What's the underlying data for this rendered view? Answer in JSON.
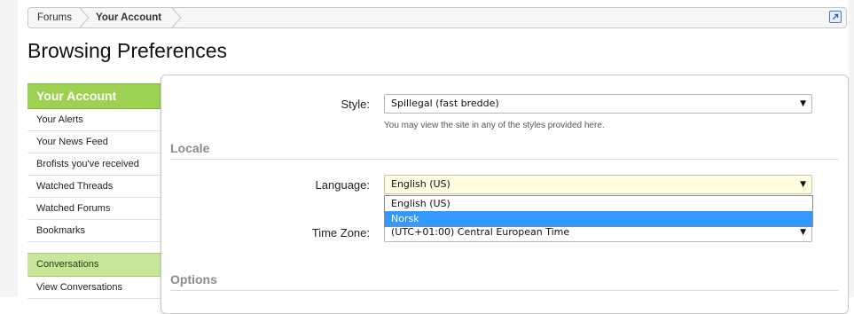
{
  "breadcrumb": {
    "items": [
      "Forums",
      "Your Account"
    ]
  },
  "page_title": "Browsing Preferences",
  "sidebar": {
    "header": "Your Account",
    "items": [
      "Your Alerts",
      "Your News Feed",
      "Brofists you've received",
      "Watched Threads",
      "Watched Forums",
      "Bookmarks"
    ],
    "section2_header": "Conversations",
    "section2_items": [
      "View Conversations"
    ]
  },
  "form": {
    "style": {
      "label": "Style:",
      "value": "Spillegal (fast bredde)",
      "hint": "You may view the site in any of the styles provided here."
    },
    "locale_title": "Locale",
    "language": {
      "label": "Language:",
      "value": "English (US)",
      "options": [
        "English (US)",
        "Norsk"
      ],
      "highlighted": "Norsk"
    },
    "timezone": {
      "label": "Time Zone:",
      "value": "(UTC+01:00) Central European Time"
    },
    "options_title": "Options"
  },
  "colors": {
    "sidebar_header": "#9dd151",
    "sidebar_subheader": "#c7e69a",
    "dropdown_highlight": "#3399ff"
  }
}
